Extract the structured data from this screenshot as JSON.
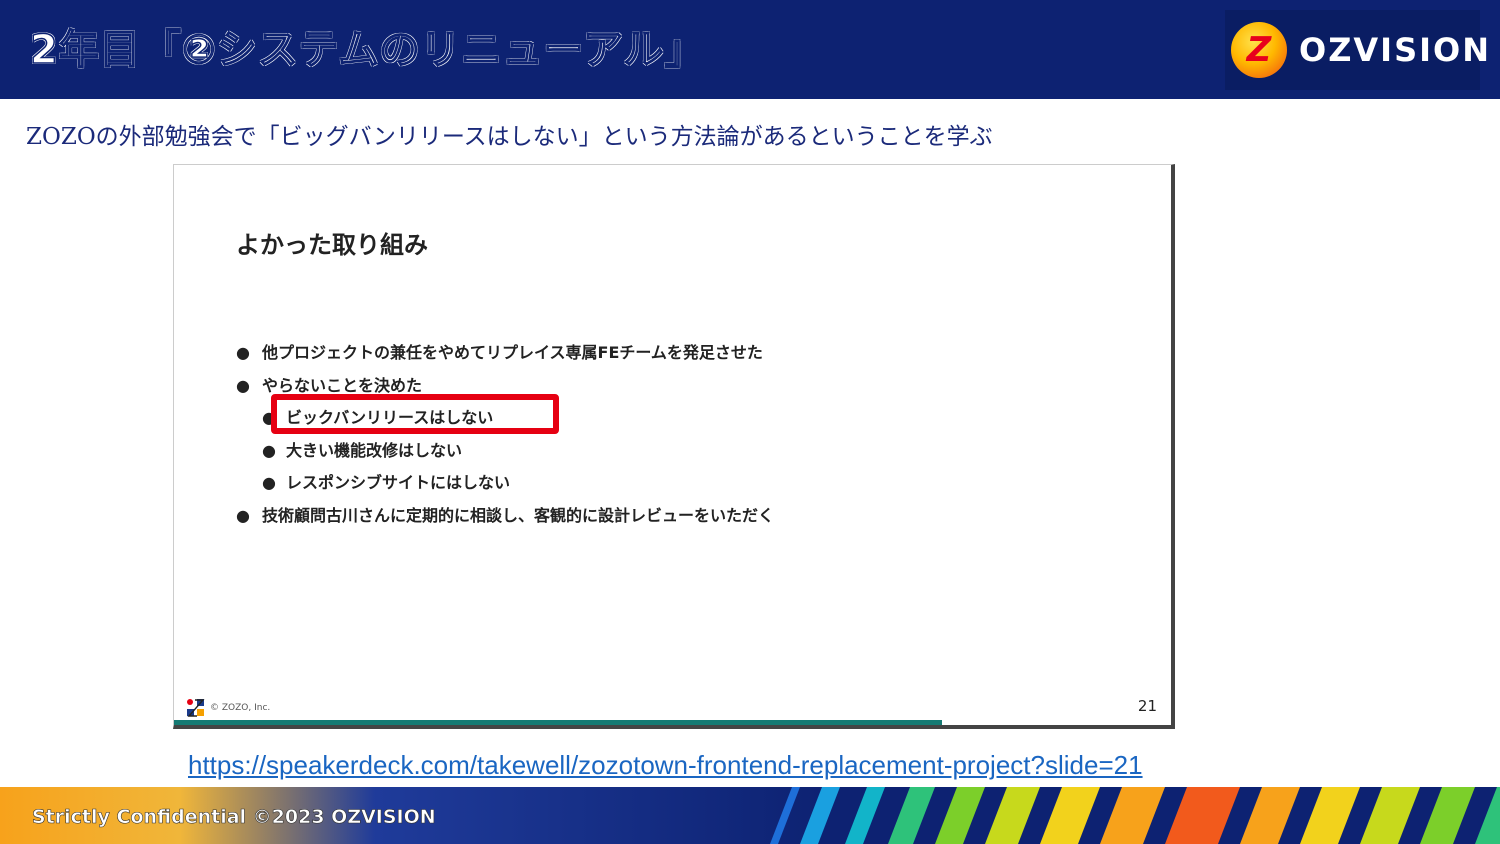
{
  "header": {
    "title": "2年目「②システムのリニューアル」",
    "logo_mark": "Z",
    "logo_text": "OZVISION"
  },
  "subtitle": "ZOZOの外部勉強会で「ビッグバンリリースはしない」という方法論があるということを学ぶ",
  "slide": {
    "heading": "よかった取り組み",
    "bullet_glyph": "●",
    "items": [
      {
        "text": "他プロジェクトの兼任をやめてリプレイス専属FEチームを発足させた",
        "level": 1
      },
      {
        "text": "やらないことを決めた",
        "level": 1
      },
      {
        "text": "ビックバンリリースはしない",
        "level": 2
      },
      {
        "text": "大きい機能改修はしない",
        "level": 2
      },
      {
        "text": "レスポンシブサイトにはしない",
        "level": 2
      },
      {
        "text": "技術顧問古川さんに定期的に相談し、客観的に設計レビューをいただく",
        "level": 1
      }
    ],
    "footer_company": "© ZOZO, Inc.",
    "page_number": "21",
    "progress": 0.77,
    "highlight_color": "#e60012"
  },
  "link": "https://speakerdeck.com/takewell/zozotown-frontend-replacement-project?slide=21",
  "footer": {
    "text": "Strictly Confidential  ©2023 OZVISION"
  },
  "colors": {
    "header_bg": "#0d2272",
    "subtitle": "#1b2a7a",
    "link": "#1a66c2",
    "progress": "#157a73"
  }
}
